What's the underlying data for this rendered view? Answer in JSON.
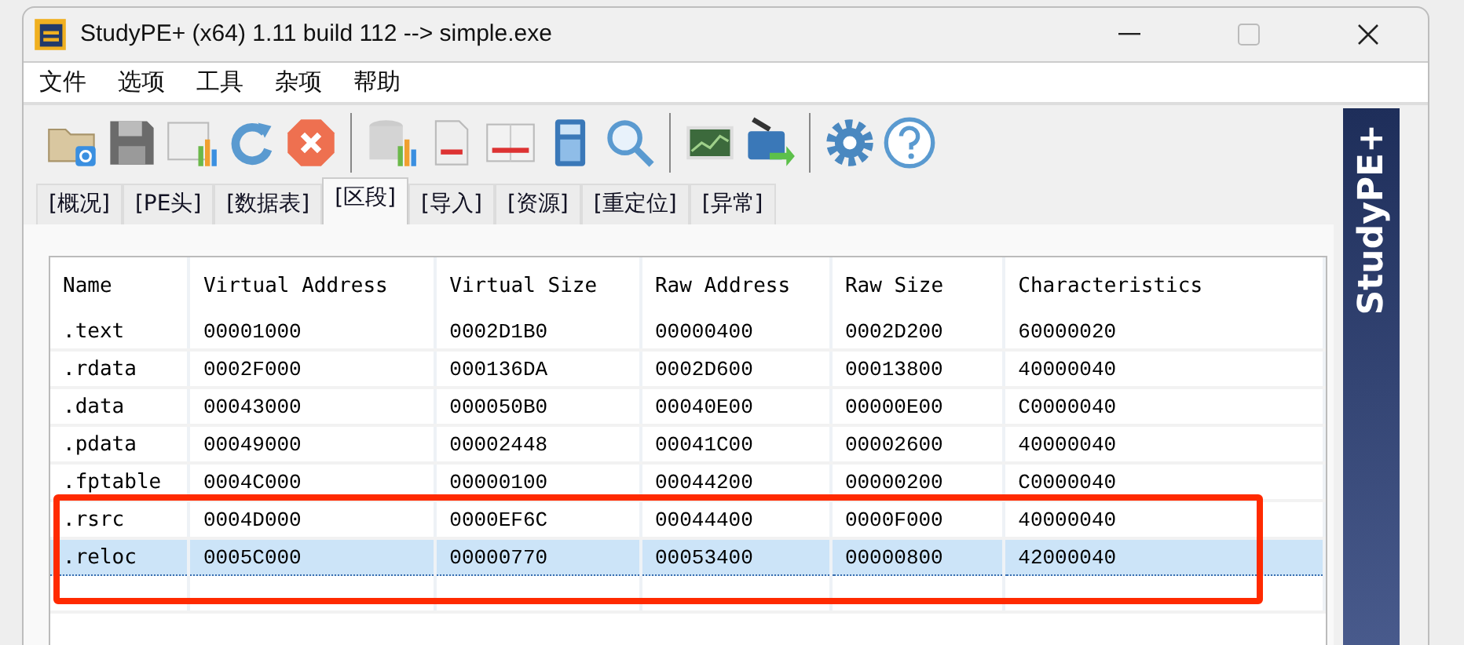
{
  "window": {
    "title": "StudyPE+ (x64) 1.11 build 112  --> simple.exe"
  },
  "menu": [
    "文件",
    "选项",
    "工具",
    "杂项",
    "帮助"
  ],
  "tabs": [
    {
      "label": "[概况]",
      "selected": false
    },
    {
      "label": "[PE头]",
      "selected": false
    },
    {
      "label": "[数据表]",
      "selected": false
    },
    {
      "label": "[区段]",
      "selected": true
    },
    {
      "label": "[导入]",
      "selected": false
    },
    {
      "label": "[资源]",
      "selected": false
    },
    {
      "label": "[重定位]",
      "selected": false
    },
    {
      "label": "[异常]",
      "selected": false
    }
  ],
  "table": {
    "columns": [
      "Name",
      "Virtual Address",
      "Virtual Size",
      "Raw Address",
      "Raw Size",
      "Characteristics"
    ],
    "rows": [
      {
        "cells": [
          ".text",
          "00001000",
          "0002D1B0",
          "00000400",
          "0002D200",
          "60000020"
        ],
        "selected": false
      },
      {
        "cells": [
          ".rdata",
          "0002F000",
          "000136DA",
          "0002D600",
          "00013800",
          "40000040"
        ],
        "selected": false
      },
      {
        "cells": [
          ".data",
          "00043000",
          "000050B0",
          "00040E00",
          "00000E00",
          "C0000040"
        ],
        "selected": false
      },
      {
        "cells": [
          ".pdata",
          "00049000",
          "00002448",
          "00041C00",
          "00002600",
          "40000040"
        ],
        "selected": false
      },
      {
        "cells": [
          ".fptable",
          "0004C000",
          "00000100",
          "00044200",
          "00000200",
          "C0000040"
        ],
        "selected": false
      },
      {
        "cells": [
          ".rsrc",
          "0004D000",
          "0000EF6C",
          "00044400",
          "0000F000",
          "40000040"
        ],
        "selected": false
      },
      {
        "cells": [
          ".reloc",
          "0005C000",
          "00000770",
          "00053400",
          "00000800",
          "42000040"
        ],
        "selected": true
      }
    ]
  },
  "banner": {
    "text": "StudyPE+"
  }
}
